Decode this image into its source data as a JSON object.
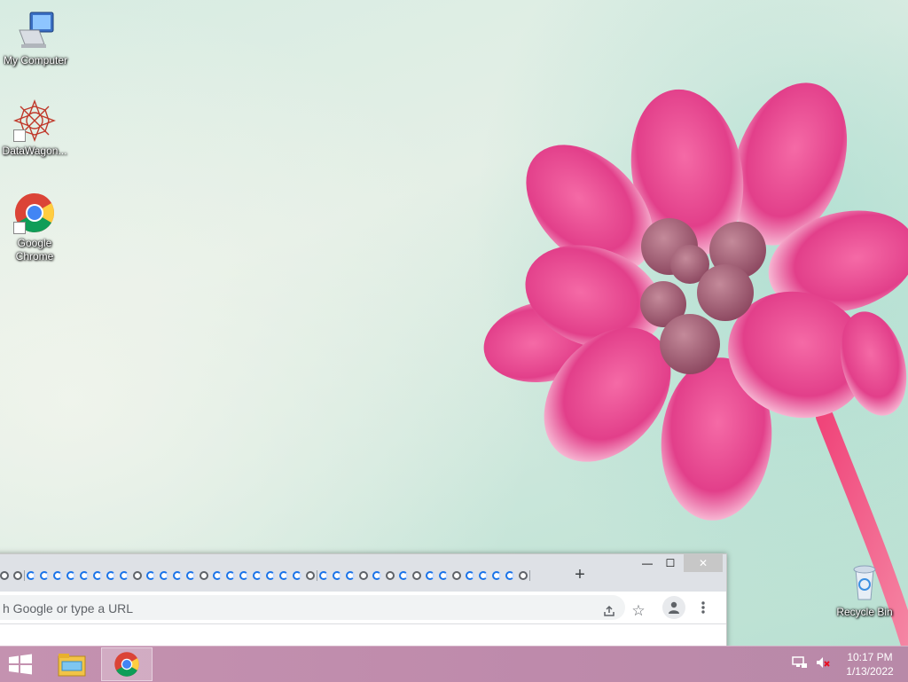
{
  "desktop": {
    "icons": [
      {
        "label": "My Computer",
        "icon": "my-computer-icon"
      },
      {
        "label": "DataWagon...",
        "icon": "datawagon-icon"
      },
      {
        "label": "Google Chrome",
        "icon": "chrome-icon"
      },
      {
        "label": "Recycle Bin",
        "icon": "recycle-bin-icon"
      }
    ]
  },
  "chrome_window": {
    "tab_count": 40,
    "new_tab_label": "+",
    "omnibox_placeholder": "h Google or type a URL",
    "controls": {
      "minimize": "—",
      "maximize": "☐",
      "close": "✕"
    }
  },
  "taskbar": {
    "items": [
      "start-button",
      "file-explorer",
      "google-chrome"
    ],
    "time": "10:17 PM",
    "date": "1/13/2022"
  },
  "colors": {
    "taskbar": "#c492b0",
    "flower": "#e23f8a",
    "chrome_tabstrip": "#dee1e6"
  }
}
